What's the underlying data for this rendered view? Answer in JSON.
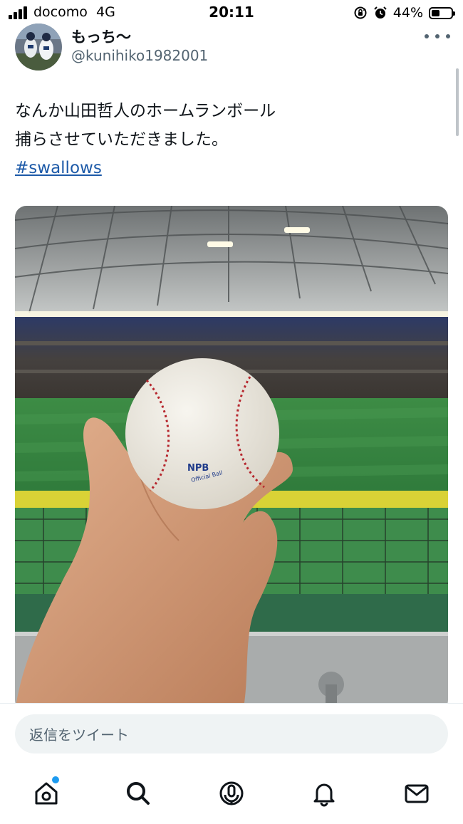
{
  "status_bar": {
    "carrier": "docomo",
    "network": "4G",
    "time": "20:11",
    "battery_percent": "44%",
    "battery_level": 0.44,
    "icons": [
      "signal-bars-icon",
      "rotation-lock-icon",
      "alarm-icon",
      "battery-icon"
    ]
  },
  "tweet": {
    "author_name": "もっち〜",
    "author_handle": "@kunihiko1982001",
    "text_lines": [
      "なんか山田哲人のホームランボール",
      "捕らさせていただきました。"
    ],
    "hashtag": "#swallows",
    "media": {
      "description_icons": [
        "baseball-stadium-photo"
      ],
      "ball_printed_text": [
        "NPB",
        "Official Ball"
      ]
    }
  },
  "reply": {
    "placeholder": "返信をツイート"
  },
  "tabbar": {
    "items": [
      "home-icon",
      "search-icon",
      "spaces-icon",
      "notifications-icon",
      "messages-icon"
    ],
    "accent_color": "#1d9bf0"
  },
  "colors": {
    "text": "#0f1419",
    "secondary_text": "#536471",
    "hashtag": "#1d5aa8",
    "input_bg": "#eff3f4"
  }
}
